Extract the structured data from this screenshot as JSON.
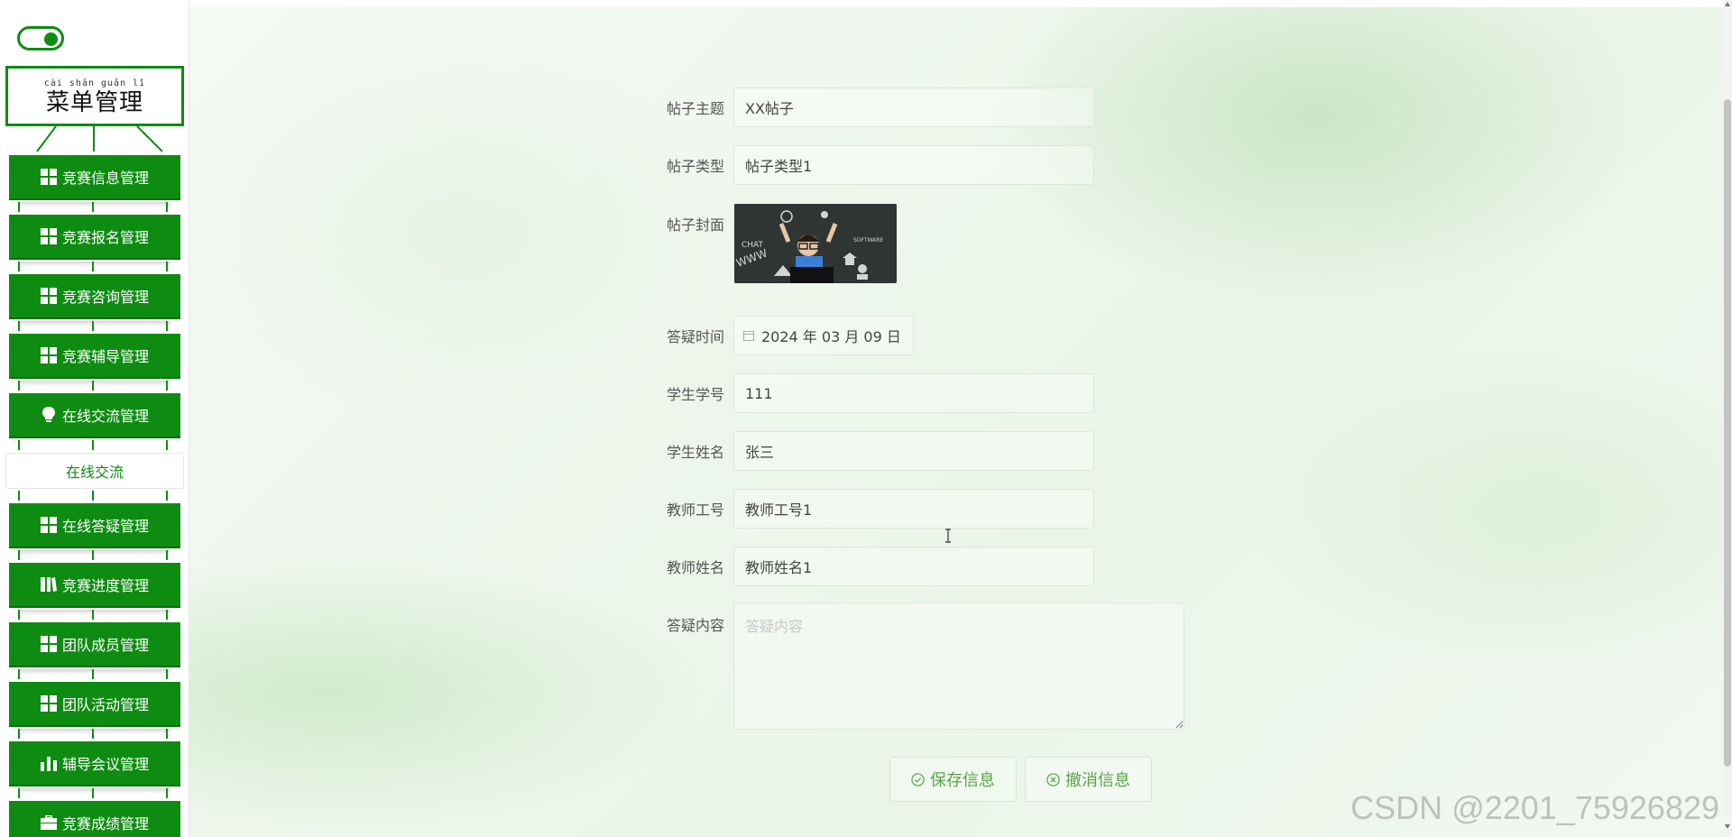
{
  "sidebar": {
    "sign": {
      "pinyin": "cài shān guǎn  lǐ",
      "title": "菜单管理"
    },
    "menu": [
      {
        "label": "竞赛信息管理",
        "icon": "grid-icon"
      },
      {
        "label": "竞赛报名管理",
        "icon": "grid-icon"
      },
      {
        "label": "竞赛咨询管理",
        "icon": "grid-icon"
      },
      {
        "label": "竞赛辅导管理",
        "icon": "grid-icon"
      },
      {
        "label": "在线交流管理",
        "icon": "lightbulb-icon"
      },
      {
        "label": "在线答疑管理",
        "icon": "grid-icon"
      },
      {
        "label": "竞赛进度管理",
        "icon": "book-icon"
      },
      {
        "label": "团队成员管理",
        "icon": "grid-icon"
      },
      {
        "label": "团队活动管理",
        "icon": "grid-icon"
      },
      {
        "label": "辅导会议管理",
        "icon": "bar-chart-icon"
      },
      {
        "label": "竞赛成绩管理",
        "icon": "briefcase-icon"
      }
    ],
    "submenu": {
      "label": "在线交流"
    }
  },
  "form": {
    "post_title": {
      "label": "帖子主题",
      "value": "XX帖子"
    },
    "post_type": {
      "label": "帖子类型",
      "value": "帖子类型1"
    },
    "post_cover": {
      "label": "帖子封面",
      "image_text": [
        "CHAT",
        "WWW",
        "SOFTWARE"
      ]
    },
    "answer_time": {
      "label": "答疑时间",
      "value": "2024 年 03 月 09 日"
    },
    "student_id": {
      "label": "学生学号",
      "value": "111"
    },
    "student_name": {
      "label": "学生姓名",
      "value": "张三"
    },
    "teacher_id": {
      "label": "教师工号",
      "value": "教师工号1"
    },
    "teacher_name": {
      "label": "教师姓名",
      "value": "教师姓名1"
    },
    "answer_content": {
      "label": "答疑内容",
      "value": "",
      "placeholder": "答疑内容"
    }
  },
  "actions": {
    "save_label": "保存信息",
    "cancel_label": "撤消信息"
  },
  "watermark": "CSDN @2201_75926829",
  "colors": {
    "brand_green": "#0e8c12",
    "button_text": "#5aa24a"
  }
}
